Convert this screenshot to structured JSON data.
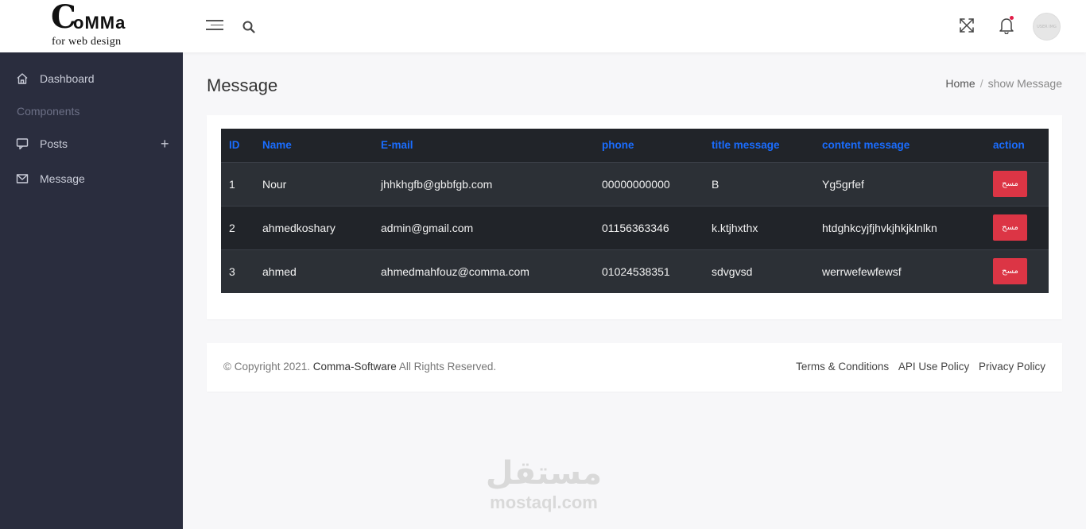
{
  "brand": {
    "logo_initial": "C",
    "logo_rest": "oMMa",
    "logo_sub": "for web design"
  },
  "header": {
    "avatar_text": "USER IMG"
  },
  "sidebar": {
    "items": [
      {
        "label": "Dashboard",
        "icon": "home-icon"
      },
      {
        "label": "Posts",
        "icon": "posts-icon",
        "expand": "+"
      },
      {
        "label": "Message",
        "icon": "envelope-icon"
      }
    ],
    "section_heading": "Components"
  },
  "page": {
    "title": "Message"
  },
  "breadcrumb": {
    "home": "Home",
    "separator": "/",
    "current": "show Message"
  },
  "table": {
    "headers": [
      "ID",
      "Name",
      "E-mail",
      "phone",
      "title message",
      "content message",
      "action"
    ],
    "rows": [
      {
        "id": "1",
        "name": "Nour",
        "email": "jhhkhgfb@gbbfgb.com",
        "phone": "00000000000",
        "title": "B",
        "content": "Yg5grfef",
        "action": "مسح"
      },
      {
        "id": "2",
        "name": "ahmedkoshary",
        "email": "admin@gmail.com",
        "phone": "01156363346",
        "title": "k.ktjhxthx",
        "content": "htdghkcyjfjhvkjhkjklnlkn",
        "action": "مسح"
      },
      {
        "id": "3",
        "name": "ahmed",
        "email": "ahmedmahfouz@comma.com",
        "phone": "01024538351",
        "title": "sdvgvsd",
        "content": "werrwefewfewsf",
        "action": "مسح"
      }
    ]
  },
  "footer": {
    "copyright_prefix": "© Copyright 2021.",
    "brand": "Comma-Software",
    "copyright_suffix": "All Rights Reserved.",
    "links": [
      "Terms & Conditions",
      "API Use Policy",
      "Privacy Policy"
    ]
  },
  "watermark": {
    "arabic": "مستقل",
    "latin": "mostaql.com"
  },
  "colors": {
    "sidebar": "#2a2d3e",
    "table_header_text": "#1a6dff",
    "danger": "#dc3545"
  }
}
